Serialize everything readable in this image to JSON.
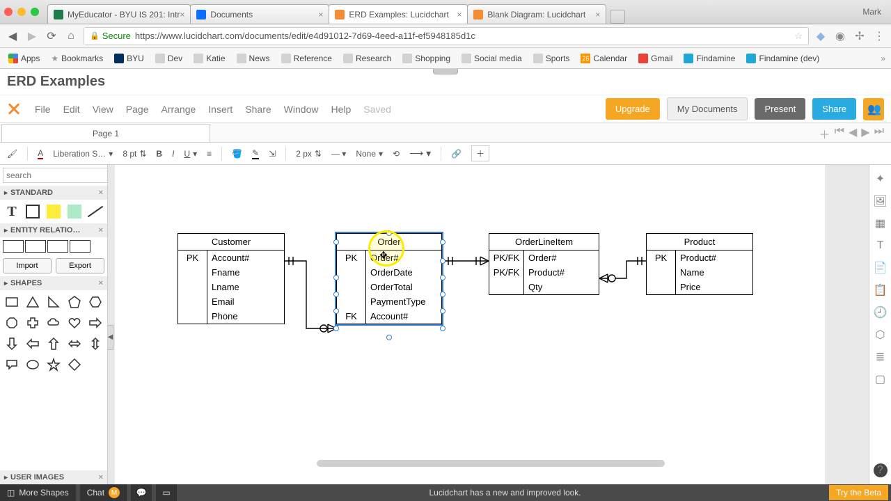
{
  "browser": {
    "username": "Mark",
    "tabs": [
      {
        "label": "MyEducator - BYU IS 201: Intr"
      },
      {
        "label": "Documents"
      },
      {
        "label": "ERD Examples: Lucidchart"
      },
      {
        "label": "Blank Diagram: Lucidchart"
      }
    ],
    "secure": "Secure",
    "url": "https://www.lucidchart.com/documents/edit/e4d91012-7d69-4eed-a11f-ef5948185d1c",
    "bookmarks": {
      "apps": "Apps",
      "bookmarks": "Bookmarks",
      "byu": "BYU",
      "dev": "Dev",
      "katie": "Katie",
      "news": "News",
      "reference": "Reference",
      "research": "Research",
      "shopping": "Shopping",
      "social": "Social media",
      "sports": "Sports",
      "cal_badge": "26",
      "calendar": "Calendar",
      "gmail": "Gmail",
      "findamine": "Findamine",
      "findamine_dev": "Findamine (dev)"
    }
  },
  "app": {
    "title": "ERD Examples",
    "menu": {
      "file": "File",
      "edit": "Edit",
      "view": "View",
      "page": "Page",
      "arrange": "Arrange",
      "insert": "Insert",
      "share": "Share",
      "window": "Window",
      "help": "Help",
      "saved": "Saved"
    },
    "buttons": {
      "upgrade": "Upgrade",
      "mydocs": "My Documents",
      "present": "Present",
      "share": "Share"
    },
    "page_tab": "Page 1",
    "toolbar": {
      "font": "Liberation S…",
      "fontsize": "8 pt",
      "stroke": "2 px",
      "linecap": "None"
    },
    "left": {
      "search_placeholder": "search",
      "standard": "STANDARD",
      "er": "ENTITY RELATIO…",
      "import": "Import",
      "export": "Export",
      "shapes": "SHAPES",
      "userimg": "USER IMAGES"
    }
  },
  "erd": {
    "customer": {
      "title": "Customer",
      "rows": [
        {
          "key": "PK",
          "attr": "Account#"
        },
        {
          "key": "",
          "attr": "Fname"
        },
        {
          "key": "",
          "attr": "Lname"
        },
        {
          "key": "",
          "attr": "Email"
        },
        {
          "key": "",
          "attr": "Phone"
        }
      ]
    },
    "order": {
      "title": "Order",
      "rows": [
        {
          "key": "PK",
          "attr": "Order#"
        },
        {
          "key": "",
          "attr": "OrderDate"
        },
        {
          "key": "",
          "attr": "OrderTotal"
        },
        {
          "key": "",
          "attr": "PaymentType"
        },
        {
          "key": "FK",
          "attr": "Account#"
        }
      ]
    },
    "oli": {
      "title": "OrderLineItem",
      "rows": [
        {
          "key": "PK/FK",
          "attr": "Order#"
        },
        {
          "key": "PK/FK",
          "attr": "Product#"
        },
        {
          "key": "",
          "attr": "Qty"
        }
      ]
    },
    "product": {
      "title": "Product",
      "rows": [
        {
          "key": "PK",
          "attr": "Product#"
        },
        {
          "key": "",
          "attr": "Name"
        },
        {
          "key": "",
          "attr": "Price"
        }
      ]
    }
  },
  "bottom": {
    "moreshapes": "More Shapes",
    "chat": "Chat",
    "msg": "Lucidchart has a new and improved look.",
    "beta": "Try the Beta"
  }
}
